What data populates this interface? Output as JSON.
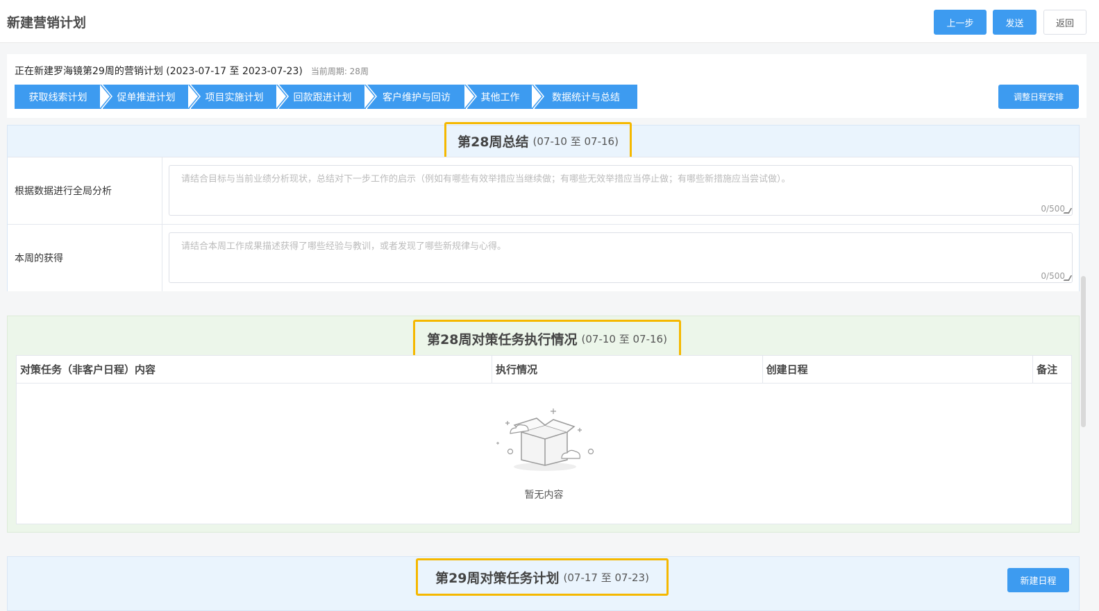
{
  "header": {
    "title": "新建营销计划",
    "prev_label": "上一步",
    "send_label": "发送",
    "back_label": "返回"
  },
  "plan": {
    "info": "正在新建罗海镜第29周的营销计划 (2023-07-17 至 2023-07-23)",
    "period": "当前周期: 28周",
    "adjust_label": "调整日程安排",
    "steps": [
      {
        "label": "获取线索计划"
      },
      {
        "label": "促单推进计划"
      },
      {
        "label": "项目实施计划"
      },
      {
        "label": "回款跟进计划"
      },
      {
        "label": "客户维护与回访"
      },
      {
        "label": "其他工作"
      },
      {
        "label": "数据统计与总结"
      }
    ]
  },
  "summary": {
    "title": "第28周总结",
    "range": "(07-10 至 07-16)",
    "rows": [
      {
        "label": "根据数据进行全局分析",
        "placeholder": "请结合目标与当前业绩分析现状，总结对下一步工作的启示（例如有哪些有效举措应当继续做；有哪些无效举措应当停止做；有哪些新措施应当尝试做）。",
        "counter": "0/500"
      },
      {
        "label": "本周的获得",
        "placeholder": "请结合本周工作成果描述获得了哪些经验与教训，或者发现了哪些新规律与心得。",
        "counter": "0/500"
      }
    ]
  },
  "tasks": {
    "title": "第28周对策任务执行情况",
    "range": "(07-10 至 07-16)",
    "columns": [
      "对策任务（非客户日程）内容",
      "执行情况",
      "创建日程",
      "备注"
    ],
    "empty_text": "暂无内容"
  },
  "plan_next": {
    "title": "第29周对策任务计划",
    "range": "(07-17 至 07-23)",
    "new_label": "新建日程"
  },
  "colors": {
    "primary": "#3d9bf0",
    "highlight": "#f5b800",
    "section_blue": "#eaf4fd",
    "section_green": "#ecf6ea"
  }
}
